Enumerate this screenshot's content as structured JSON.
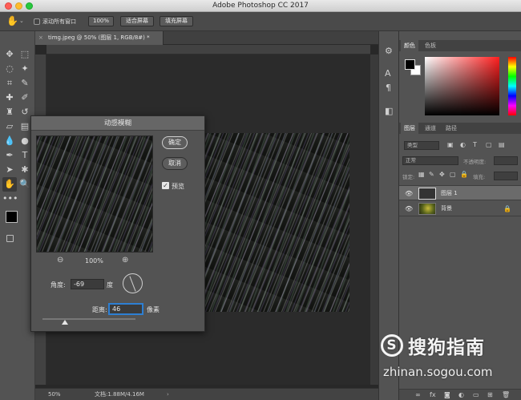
{
  "window": {
    "title": "Adobe Photoshop CC 2017"
  },
  "options_bar": {
    "scroll_all_label": "滚动所有窗口",
    "zoom_100": "100%",
    "fit_screen": "适合屏幕",
    "fill_screen": "填充屏幕"
  },
  "document": {
    "tab_label": "timg.jpeg @ 50% (图层 1, RGB/8#) *",
    "zoom_status": "50%",
    "doc_info": "文档:1.88M/4.16M"
  },
  "dialog": {
    "title": "动感模糊",
    "ok_label": "确定",
    "cancel_label": "取消",
    "preview_label": "预览",
    "preview_checked": true,
    "preview_zoom": "100%",
    "angle_label": "角度:",
    "angle_value": "-69",
    "angle_unit": "度",
    "distance_label": "距离:",
    "distance_value": "46",
    "distance_unit": "像素"
  },
  "panels": {
    "color_tabs": [
      "颜色",
      "色板"
    ],
    "layers_tabs": [
      "图层",
      "通道",
      "路径"
    ],
    "filter_kind": "类型",
    "blend_mode": "正常",
    "opacity_label": "不透明度:",
    "lock_label": "锁定:",
    "fill_label": "填充:",
    "layers": [
      {
        "name": "图层 1",
        "selected": true
      },
      {
        "name": "背景",
        "selected": false,
        "locked": true
      }
    ]
  },
  "watermark": {
    "brand": "搜狗指南",
    "url": "zhinan.sogou.com"
  },
  "colors": {
    "accent_active_field": "#2d7fd3",
    "foreground_swatch": "#000000",
    "background_swatch": "#ffffff"
  }
}
